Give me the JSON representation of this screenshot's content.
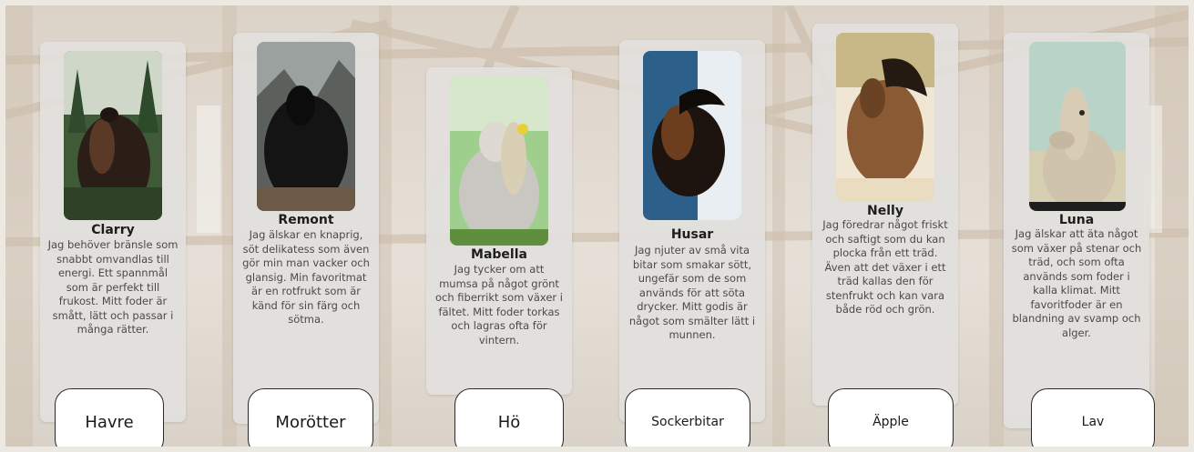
{
  "cards": [
    {
      "name": "Clarry",
      "description": "Jag behöver bränsle som snabbt omvandlas till energi. Ett spannmål som är perfekt till frukost. Mitt foder är smått, lätt och passar i många rätter."
    },
    {
      "name": "Remont",
      "description": "Jag älskar en knaprig, söt delikatess som även gör min man vacker och glansig. Min favoritmat är en rotfrukt som är känd för sin färg och sötma."
    },
    {
      "name": "Mabella",
      "description": "Jag tycker om att mumsa på något grönt och fiberrikt som växer i fältet. Mitt foder torkas och lagras ofta för vintern."
    },
    {
      "name": "Husar",
      "description": "Jag njuter av små vita bitar som smakar sött, ungefär som de som används för att söta drycker. Mitt godis är något som smälter lätt i munnen."
    },
    {
      "name": "Nelly",
      "description": "Jag föredrar något friskt och saftigt som du kan plocka från ett träd. Även att det växer i ett träd kallas den för stenfrukt och kan vara både röd och grön."
    },
    {
      "name": "Luna",
      "description": "Jag älskar att äta något som växer på stenar och träd, och som ofta används som foder i kalla klimat. Mitt favoritfoder är en blandning av svamp och alger."
    }
  ],
  "answers": [
    "Havre",
    "Morötter",
    "Hö",
    "Sockerbitar",
    "Äpple",
    "Lav"
  ],
  "colors": {
    "card_bg": "#e2e0dd",
    "answer_border": "#2a2a2a"
  }
}
